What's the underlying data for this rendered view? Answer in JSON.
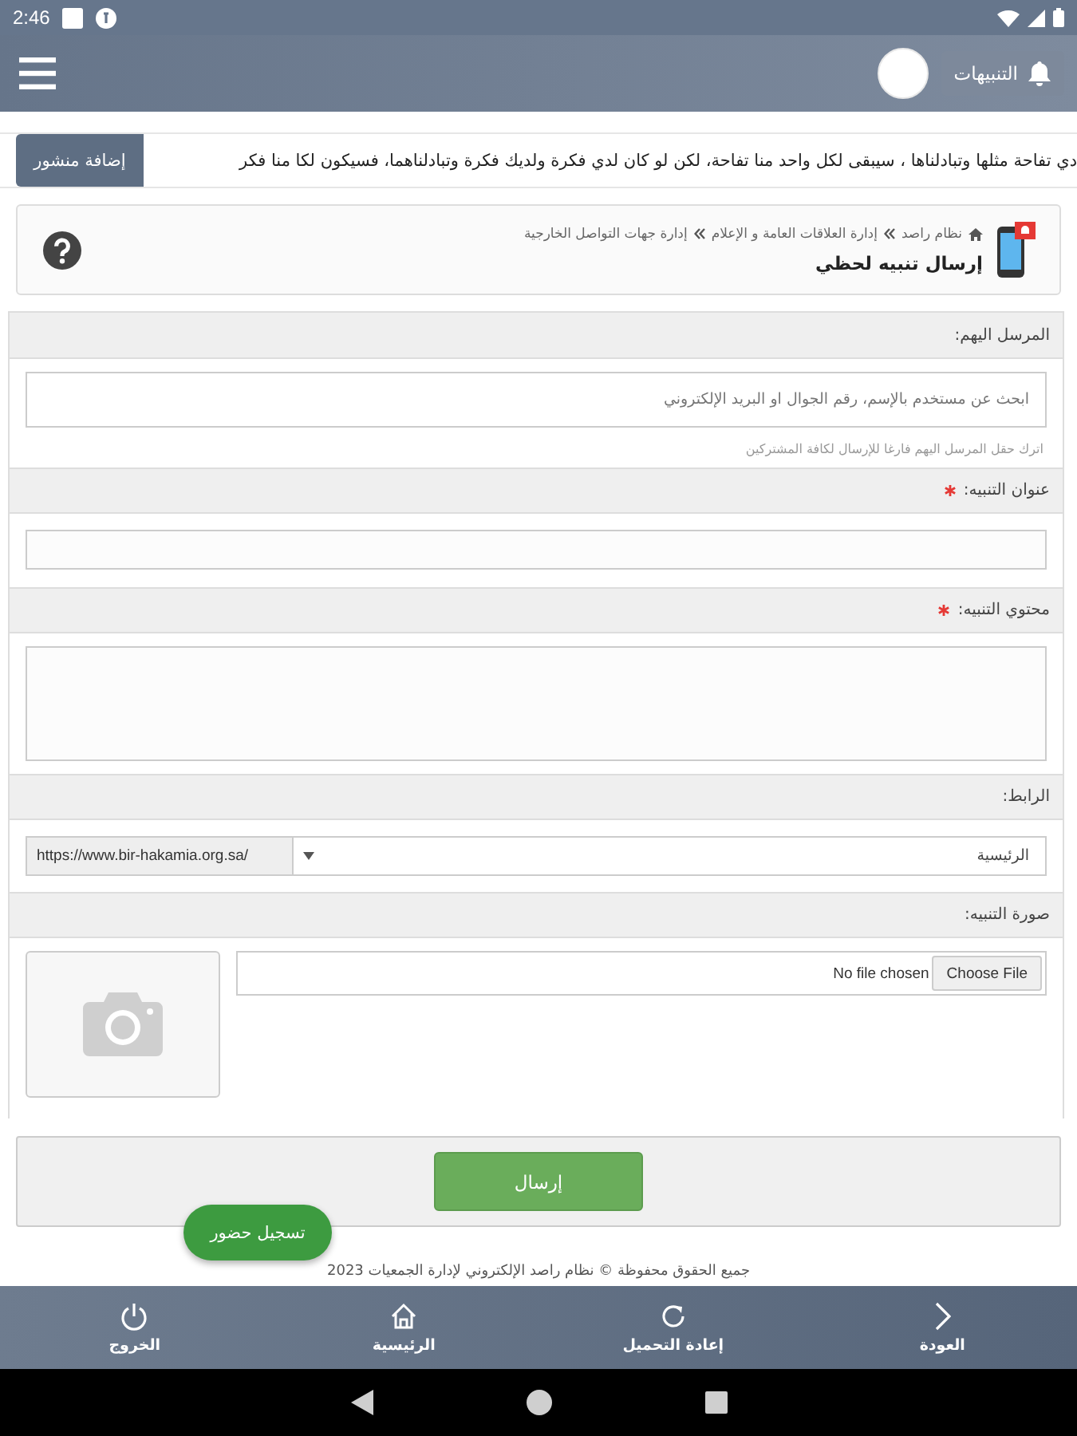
{
  "status_bar": {
    "time": "2:46"
  },
  "app_bar": {
    "notifications_button": "التنبيهات"
  },
  "ticker": {
    "add_post_button": "إضافة منشور",
    "text": "دي تفاحة مثلها وتبادلناها ، سيبقى لكل واحد منا تفاحة، لكن لو كان لدي فكرة ولديك فكرة وتبادلناهما، فسيكون لكا منا فكر"
  },
  "page_header": {
    "breadcrumb": [
      "نظام راصد",
      "إدارة العلاقات العامة و الإعلام",
      "إدارة جهات التواصل الخارجية"
    ],
    "title": "إرسال تنبيه لحظي"
  },
  "form": {
    "sections": [
      {
        "kind": "search",
        "label": "المرسل اليهم:",
        "required": false,
        "placeholder": "ابحث عن مستخدم بالإسم، رقم الجوال او البريد الإلكتروني",
        "help": "اترك حقل المرسل اليهم فارغا للإرسال لكافة المشتركين"
      },
      {
        "kind": "text",
        "label": "عنوان التنبيه:",
        "required": true
      },
      {
        "kind": "textarea",
        "label": "محتوي التنبيه:",
        "required": true
      },
      {
        "kind": "link",
        "label": "الرابط:",
        "required": false,
        "prefix": "https://www.bir-hakamia.org.sa/",
        "value": "الرئيسية"
      },
      {
        "kind": "image",
        "label": "صورة التنبيه:",
        "required": false,
        "file_button": "Choose File",
        "file_status": "No file chosen"
      }
    ]
  },
  "submit_button": "إرسال",
  "attendance_button": "تسجيل حضور",
  "footer": "جميع الحقوق محفوظة © نظام راصد الإلكتروني لإدارة الجمعيات 2023",
  "bottom_nav": [
    {
      "kind": "back",
      "label": "العودة"
    },
    {
      "kind": "reload",
      "label": "إعادة التحميل"
    },
    {
      "kind": "home",
      "label": "الرئيسية"
    },
    {
      "kind": "logout",
      "label": "الخروج"
    }
  ]
}
